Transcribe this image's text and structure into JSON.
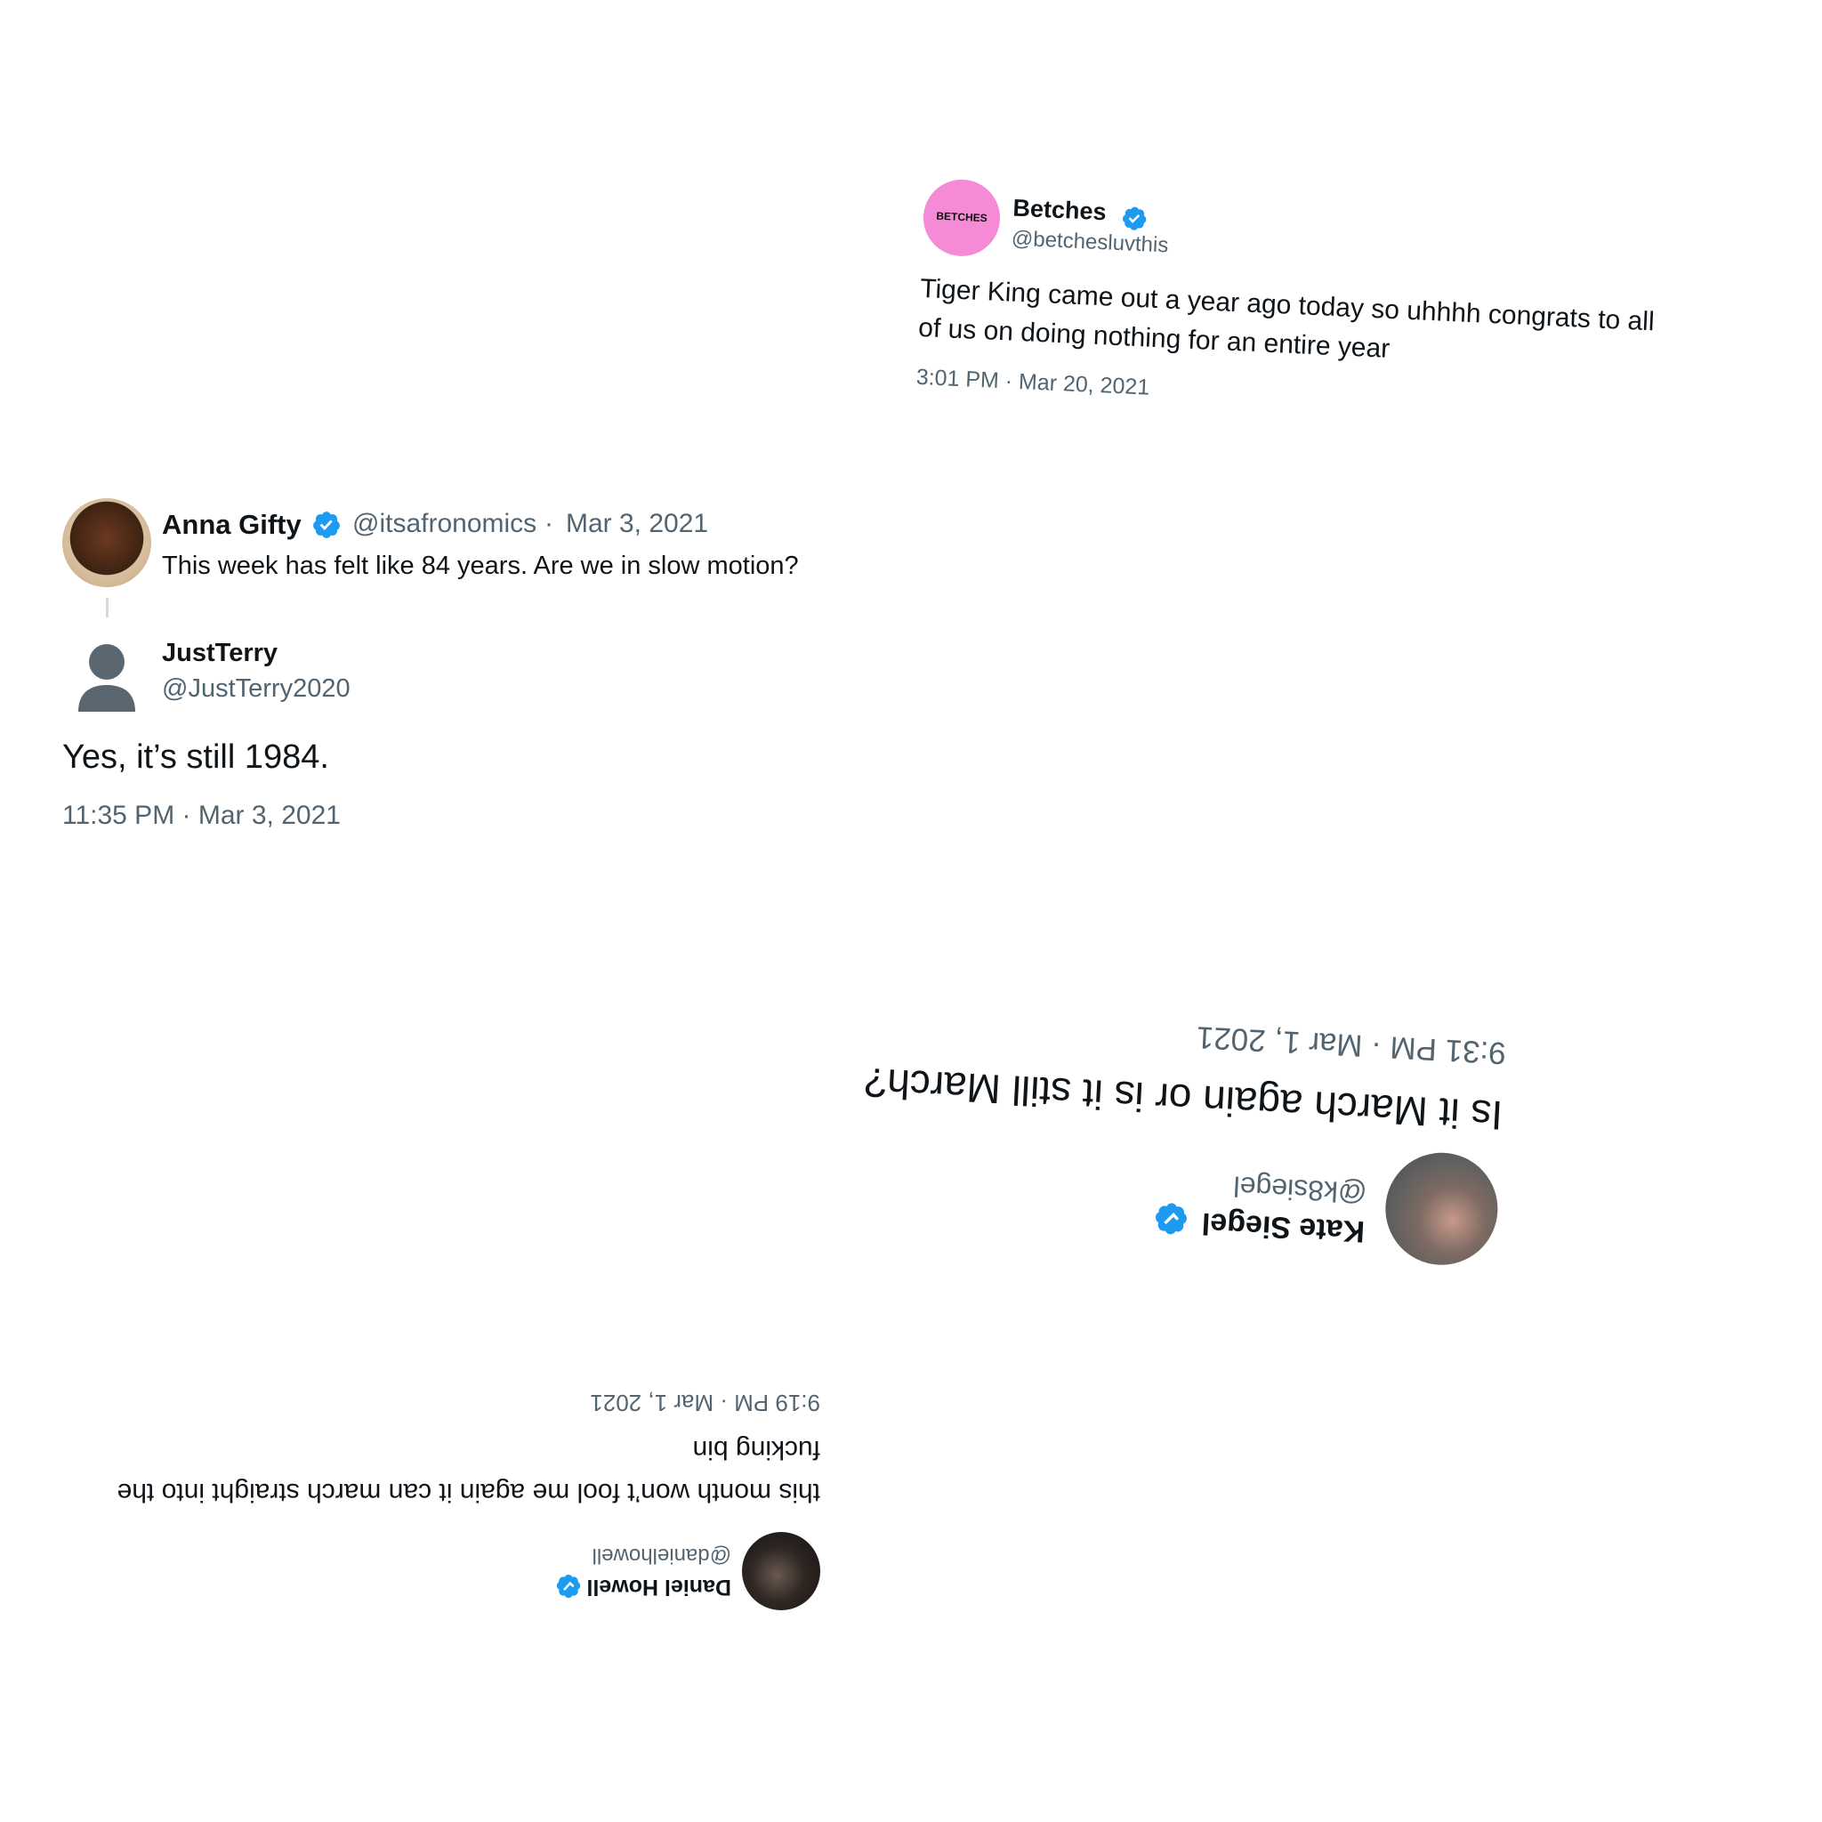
{
  "tweets": {
    "betches": {
      "name": "Betches",
      "handle": "@betchesluvthis",
      "avatar_text": "BETCHES",
      "text_line1": "Tiger King came out a year ago today so uhhhh congrats to all",
      "text_line2": "of us on doing nothing for an entire year",
      "timestamp": "3:01 PM · Mar 20, 2021"
    },
    "anna": {
      "name": "Anna Gifty",
      "handle": "@itsafronomics",
      "separator": "·",
      "date": "Mar 3, 2021",
      "text": "This week has felt like 84 years. Are we in slow motion?"
    },
    "terry": {
      "name": "JustTerry",
      "handle": "@JustTerry2020",
      "text": "Yes, it’s still 1984.",
      "timestamp": "11:35 PM · Mar 3, 2021"
    },
    "kate": {
      "name": "Kate Siegel",
      "handle": "@k8siegel",
      "text": "Is it March again or is it still March?",
      "timestamp": "9:31 PM · Mar 1, 2021"
    },
    "daniel": {
      "name": "Daniel Howell",
      "handle": "@danielhowell",
      "text_line1": "this month won’t fool me again it can march straight into the",
      "text_line2": "fucking bin",
      "timestamp": "9:19 PM · Mar 1, 2021"
    }
  },
  "colors": {
    "verified": "#1d9bf0",
    "text": "#0f1419",
    "secondary": "#536471",
    "betches_pink": "#f58ad6"
  }
}
